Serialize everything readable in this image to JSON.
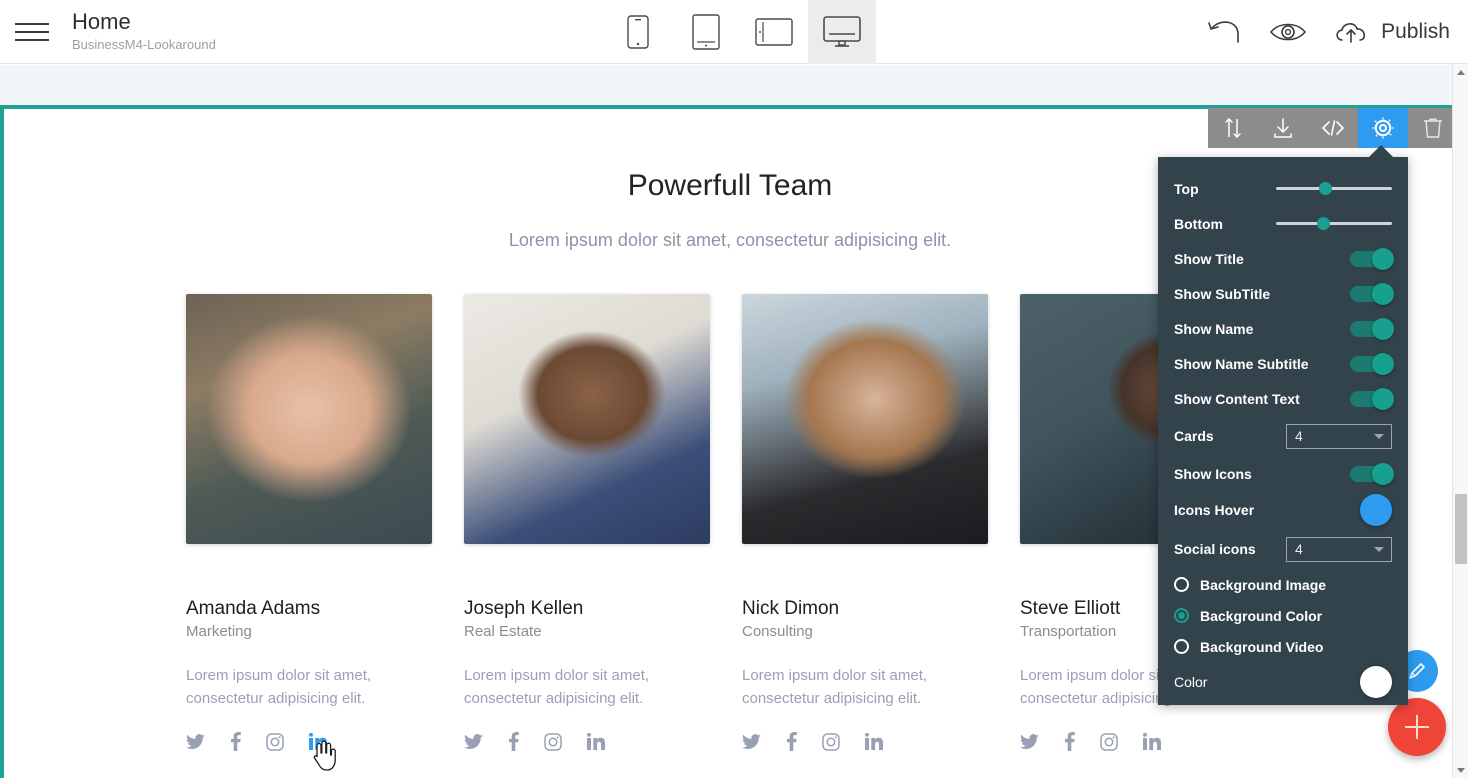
{
  "topbar": {
    "menu_icon": "hamburger-icon",
    "title": "Home",
    "subtitle": "BusinessM4-Lookaround",
    "devices": [
      {
        "name": "mobile",
        "label": "Mobile",
        "active": false
      },
      {
        "name": "tablet-portrait",
        "label": "Tablet Portrait",
        "active": false
      },
      {
        "name": "tablet-landscape",
        "label": "Tablet Landscape",
        "active": false
      },
      {
        "name": "desktop",
        "label": "Desktop",
        "active": true
      }
    ],
    "undo_icon": "undo-icon",
    "preview_icon": "eye-icon",
    "publish_icon": "cloud-upload-icon",
    "publish_label": "Publish"
  },
  "block_toolbar": {
    "buttons": [
      {
        "name": "move-block",
        "icon": "up-down-arrows-icon",
        "active": false
      },
      {
        "name": "download-block",
        "icon": "download-icon",
        "active": false
      },
      {
        "name": "edit-code",
        "icon": "code-icon",
        "active": false
      },
      {
        "name": "block-settings",
        "icon": "gear-icon",
        "active": true
      },
      {
        "name": "delete-block",
        "icon": "trash-icon",
        "active": false
      }
    ],
    "active_color": "#2d9cf0",
    "bar_color": "#8c8c8c"
  },
  "section": {
    "title": "Powerfull Team",
    "subtitle": "Lorem ipsum dolor sit amet, consectetur adipisicing elit.",
    "selection_color": "#1fa295",
    "cards": [
      {
        "name": "Amanda Adams",
        "role": "Marketing",
        "text": "Lorem ipsum dolor sit amet, consectetur adipisicing elit.",
        "photo": "portrait-woman-blonde",
        "social": [
          {
            "name": "twitter-icon",
            "hover": false
          },
          {
            "name": "facebook-icon",
            "hover": false
          },
          {
            "name": "instagram-icon",
            "hover": false
          },
          {
            "name": "linkedin-icon",
            "hover": true
          }
        ]
      },
      {
        "name": "Joseph Kellen",
        "role": "Real Estate",
        "text": "Lorem ipsum dolor sit amet, consectetur adipisicing elit.",
        "photo": "portrait-man-blue-suit",
        "social": [
          {
            "name": "twitter-icon",
            "hover": false
          },
          {
            "name": "facebook-icon",
            "hover": false
          },
          {
            "name": "instagram-icon",
            "hover": false
          },
          {
            "name": "linkedin-icon",
            "hover": false
          }
        ]
      },
      {
        "name": "Nick Dimon",
        "role": "Consulting",
        "text": "Lorem ipsum dolor sit amet, consectetur adipisicing elit.",
        "photo": "portrait-woman-hat",
        "social": [
          {
            "name": "twitter-icon",
            "hover": false
          },
          {
            "name": "facebook-icon",
            "hover": false
          },
          {
            "name": "instagram-icon",
            "hover": false
          },
          {
            "name": "linkedin-icon",
            "hover": false
          }
        ]
      },
      {
        "name": "Steve Elliott",
        "role": "Transportation",
        "text": "Lorem ipsum dolor sit amet, consectetur adipisicing elit.",
        "photo": "portrait-man-vest",
        "social": [
          {
            "name": "twitter-icon",
            "hover": false
          },
          {
            "name": "facebook-icon",
            "hover": false
          },
          {
            "name": "instagram-icon",
            "hover": false
          },
          {
            "name": "linkedin-icon",
            "hover": false
          }
        ]
      }
    ]
  },
  "settings": {
    "panel_bg": "#33434b",
    "accent": "#16a08d",
    "sliders": [
      {
        "label": "Top",
        "value": 37
      },
      {
        "label": "Bottom",
        "value": 35
      }
    ],
    "toggles": [
      {
        "label": "Show Title",
        "on": true
      },
      {
        "label": "Show SubTitle",
        "on": true
      },
      {
        "label": "Show Name",
        "on": true
      },
      {
        "label": "Show Name Subtitle",
        "on": true
      },
      {
        "label": "Show Content Text",
        "on": true
      }
    ],
    "cards_select": {
      "label": "Cards",
      "value": "4"
    },
    "show_icons": {
      "label": "Show Icons",
      "on": true
    },
    "icons_hover": {
      "label": "Icons Hover",
      "color": "#2d9cf0"
    },
    "social_icons_select": {
      "label": "Social icons",
      "value": "4"
    },
    "background_options": [
      {
        "label": "Background Image",
        "selected": false
      },
      {
        "label": "Background Color",
        "selected": true
      },
      {
        "label": "Background Video",
        "selected": false
      }
    ],
    "color_row": {
      "label": "Color",
      "color": "#ffffff"
    }
  },
  "fabs": [
    {
      "name": "style-pen-fab",
      "icon": "pen-icon",
      "color": "#2d9cf0"
    },
    {
      "name": "add-block-fab",
      "icon": "plus-icon",
      "color": "#ef4438"
    }
  ],
  "scrollbar": {
    "up_icon": "caret-up-icon",
    "down_icon": "caret-down-icon"
  }
}
